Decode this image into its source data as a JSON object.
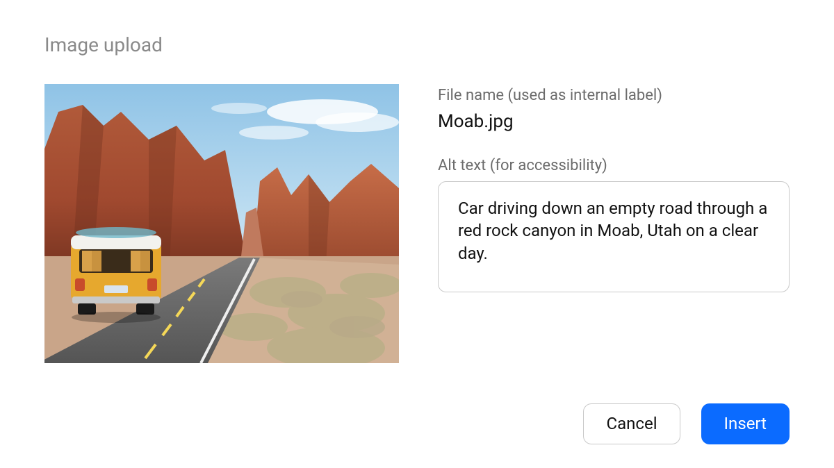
{
  "dialog": {
    "title": "Image upload"
  },
  "file_name": {
    "label": "File name (used as internal label)",
    "value": "Moab.jpg"
  },
  "alt_text": {
    "label": "Alt text (for accessibility)",
    "value": "Car driving down an empty road through a red rock canyon in Moab, Utah on a clear day."
  },
  "buttons": {
    "cancel": "Cancel",
    "insert": "Insert"
  }
}
